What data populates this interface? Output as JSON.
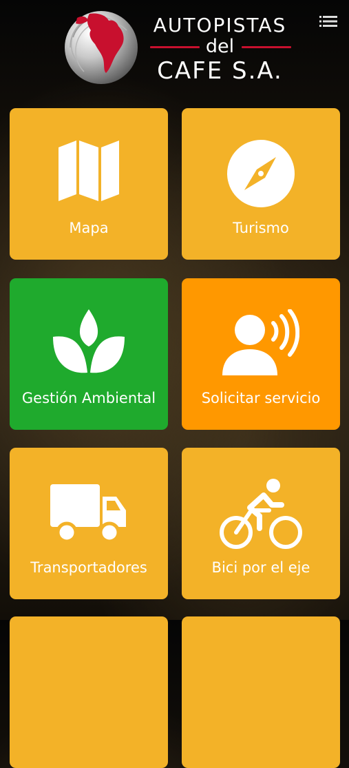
{
  "header": {
    "brand_line1": "AUTOPISTAS",
    "brand_line2": "del",
    "brand_line3": "CAFE S.A.",
    "menu_icon": "list-icon"
  },
  "colors": {
    "tile_yellow": "#f3b228",
    "tile_green": "#1faa2d",
    "tile_orange": "#ff9800",
    "logo_red": "#c8102e",
    "text": "#ffffff"
  },
  "tiles": [
    {
      "label": "Mapa",
      "icon": "map-icon",
      "color": "#f3b228"
    },
    {
      "label": "Turismo",
      "icon": "compass-icon",
      "color": "#f3b228"
    },
    {
      "label": "Gestión Ambiental",
      "icon": "leaf-icon",
      "color": "#1faa2d"
    },
    {
      "label": "Solicitar servicio",
      "icon": "voice-request-icon",
      "color": "#ff9800"
    },
    {
      "label": "Transportadores",
      "icon": "truck-icon",
      "color": "#f3b228"
    },
    {
      "label": "Bici por el eje",
      "icon": "bicycle-icon",
      "color": "#f3b228"
    },
    {
      "label": "",
      "icon": "",
      "color": "#f3b228"
    },
    {
      "label": "",
      "icon": "",
      "color": "#f3b228"
    }
  ]
}
